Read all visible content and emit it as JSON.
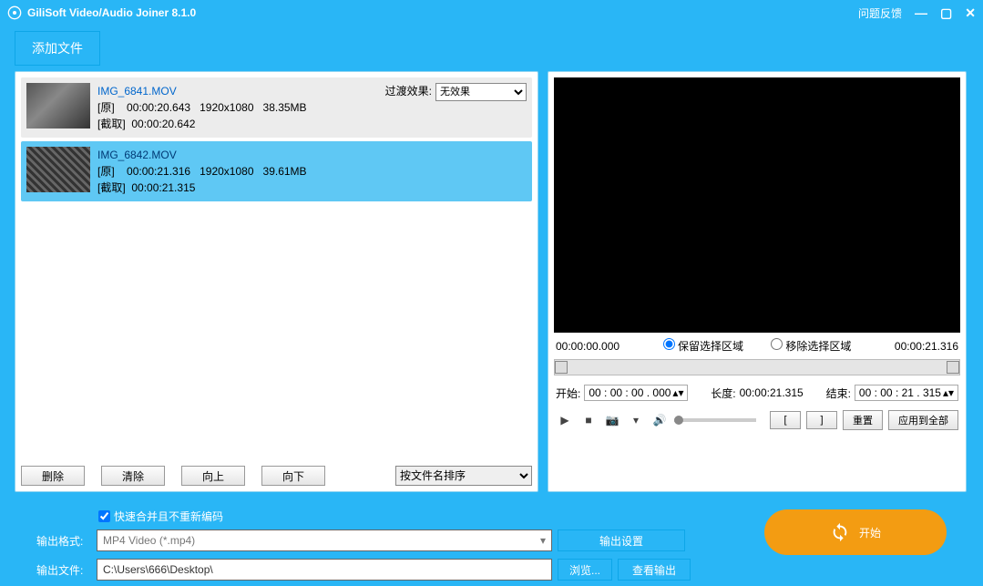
{
  "title": "GiliSoft Video/Audio Joiner 8.1.0",
  "feedback": "问题反馈",
  "add_file": "添加文件",
  "files": [
    {
      "name": "IMG_6841.MOV",
      "source_label": "[原]",
      "duration": "00:00:20.643",
      "resolution": "1920x1080",
      "size": "38.35MB",
      "cut_label": "[截取]",
      "cut_time": "00:00:20.642",
      "transition_label": "过渡效果:",
      "transition_value": "无效果"
    },
    {
      "name": "IMG_6842.MOV",
      "source_label": "[原]",
      "duration": "00:00:21.316",
      "resolution": "1920x1080",
      "size": "39.61MB",
      "cut_label": "[截取]",
      "cut_time": "00:00:21.315"
    }
  ],
  "list_buttons": {
    "delete": "删除",
    "clear": "清除",
    "up": "向上",
    "down": "向下"
  },
  "sort_value": "按文件名排序",
  "preview": {
    "time_left": "00:00:00.000",
    "time_right": "00:00:21.316",
    "keep_region": "保留选择区域",
    "remove_region": "移除选择区域",
    "start_label": "开始:",
    "start_value": "00 : 00 : 00 . 000",
    "length_label": "长度:",
    "length_value": "00:00:21.315",
    "end_label": "结束:",
    "end_value": "00 : 00 : 21 . 315",
    "mark_in": "[",
    "mark_out": "]",
    "reset": "重置",
    "apply_all": "应用到全部"
  },
  "output": {
    "fast_merge": "快速合并且不重新编码",
    "format_label": "输出格式:",
    "format_value": "MP4 Video (*.mp4)",
    "settings_btn": "输出设置",
    "file_label": "输出文件:",
    "file_value": "C:\\Users\\666\\Desktop\\",
    "browse": "浏览...",
    "view_output": "查看输出"
  },
  "start": "开始"
}
